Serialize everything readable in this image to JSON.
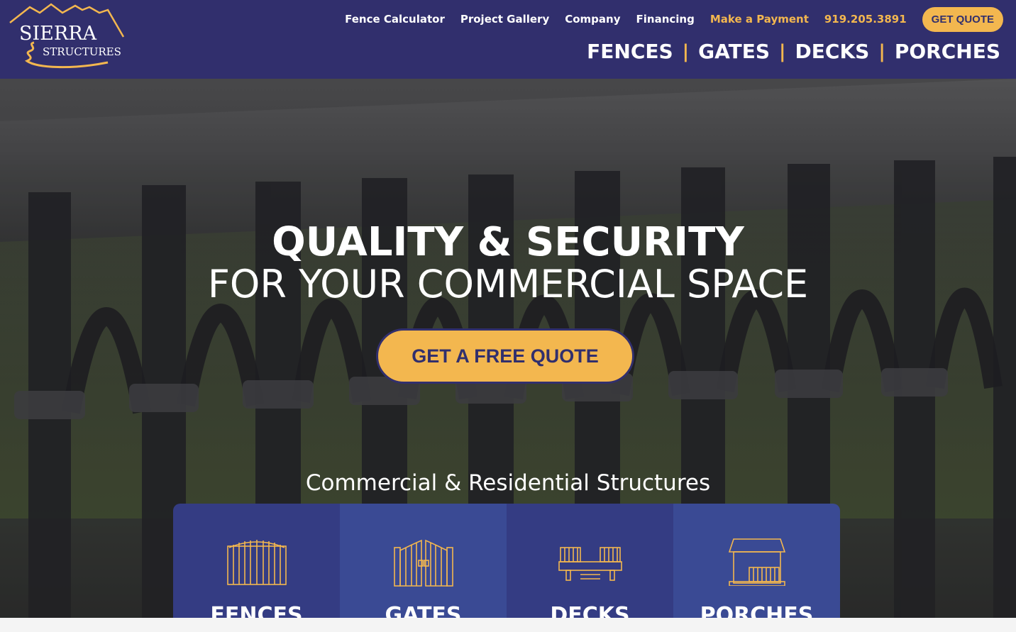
{
  "brand": {
    "name_line1": "SIERRA",
    "name_line2": "STRUCTURES",
    "colors": {
      "navy": "#312f6d",
      "gold": "#f3b74f"
    }
  },
  "topnav": {
    "links": [
      "Fence Calculator",
      "Project Gallery",
      "Company",
      "Financing"
    ],
    "payment": "Make a Payment",
    "phone": "919.205.3891",
    "quote_button": "GET QUOTE"
  },
  "mainnav": {
    "items": [
      "FENCES",
      "GATES",
      "DECKS",
      "PORCHES"
    ],
    "separator": "|"
  },
  "hero": {
    "headline_bold": "QUALITY & SECURITY",
    "headline_light": "FOR YOUR COMMERCIAL SPACE",
    "cta": "GET A FREE QUOTE",
    "subtitle": "Commercial & Residential Structures"
  },
  "cards": [
    {
      "label": "FENCES",
      "icon": "fence-icon"
    },
    {
      "label": "GATES",
      "icon": "gate-icon"
    },
    {
      "label": "DECKS",
      "icon": "deck-icon"
    },
    {
      "label": "PORCHES",
      "icon": "porch-icon"
    }
  ]
}
